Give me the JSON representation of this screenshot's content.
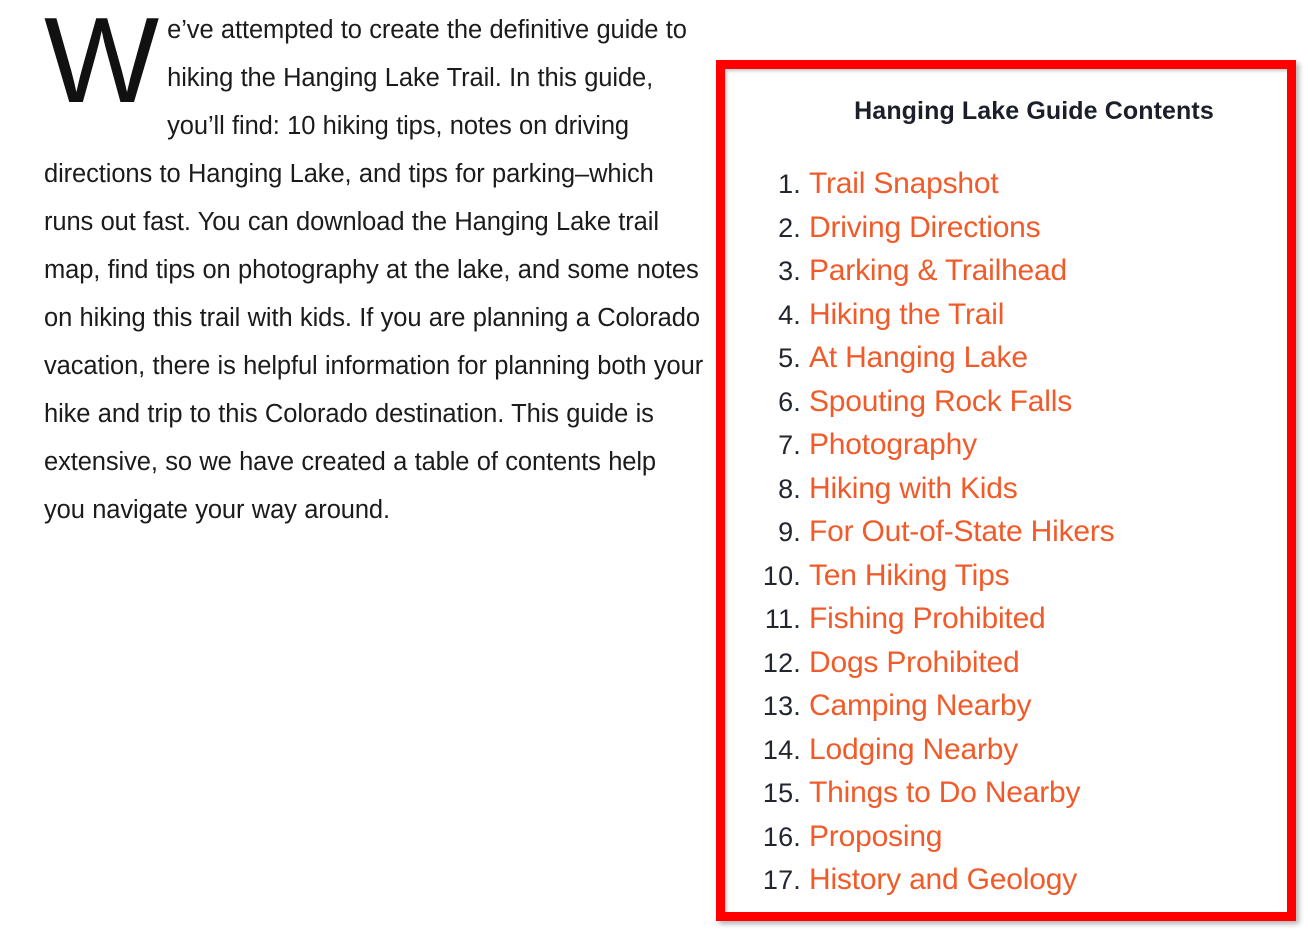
{
  "article": {
    "dropcap": "W",
    "body": "e’ve attempted to create the definitive guide to hiking the Hanging Lake Trail. In this guide, you’ll find: 10 hiking tips, notes on driving directions to Hanging Lake, and tips for parking–which runs out fast. You can download the Hanging Lake trail map, find tips on photography at the lake, and some notes on hiking this trail with kids. If you are planning a Colorado vacation, there is helpful information for planning both your hike and trip to this Colorado destination. This guide is extensive, so we have created a table of contents help you navigate your way around."
  },
  "contents_box": {
    "heading": "Hanging Lake Guide Contents",
    "border_color": "#ff0000",
    "link_color": "#f15a29",
    "number_color": "#22262e",
    "items": [
      {
        "number": "1.",
        "label": "Trail Snapshot"
      },
      {
        "number": "2.",
        "label": "Driving Directions"
      },
      {
        "number": "3.",
        "label": "Parking & Trailhead"
      },
      {
        "number": "4.",
        "label": "Hiking the Trail"
      },
      {
        "number": "5.",
        "label": "At Hanging Lake"
      },
      {
        "number": "6.",
        "label": "Spouting Rock Falls"
      },
      {
        "number": "7.",
        "label": "Photography"
      },
      {
        "number": "8.",
        "label": "Hiking with Kids"
      },
      {
        "number": "9.",
        "label": "For Out-of-State Hikers"
      },
      {
        "number": "10.",
        "label": "Ten Hiking Tips"
      },
      {
        "number": "11.",
        "label": "Fishing Prohibited"
      },
      {
        "number": "12.",
        "label": "Dogs Prohibited"
      },
      {
        "number": "13.",
        "label": "Camping Nearby"
      },
      {
        "number": "14.",
        "label": "Lodging Nearby"
      },
      {
        "number": "15.",
        "label": "Things to Do Nearby"
      },
      {
        "number": "16.",
        "label": "Proposing"
      },
      {
        "number": "17.",
        "label": "History and Geology"
      }
    ]
  }
}
